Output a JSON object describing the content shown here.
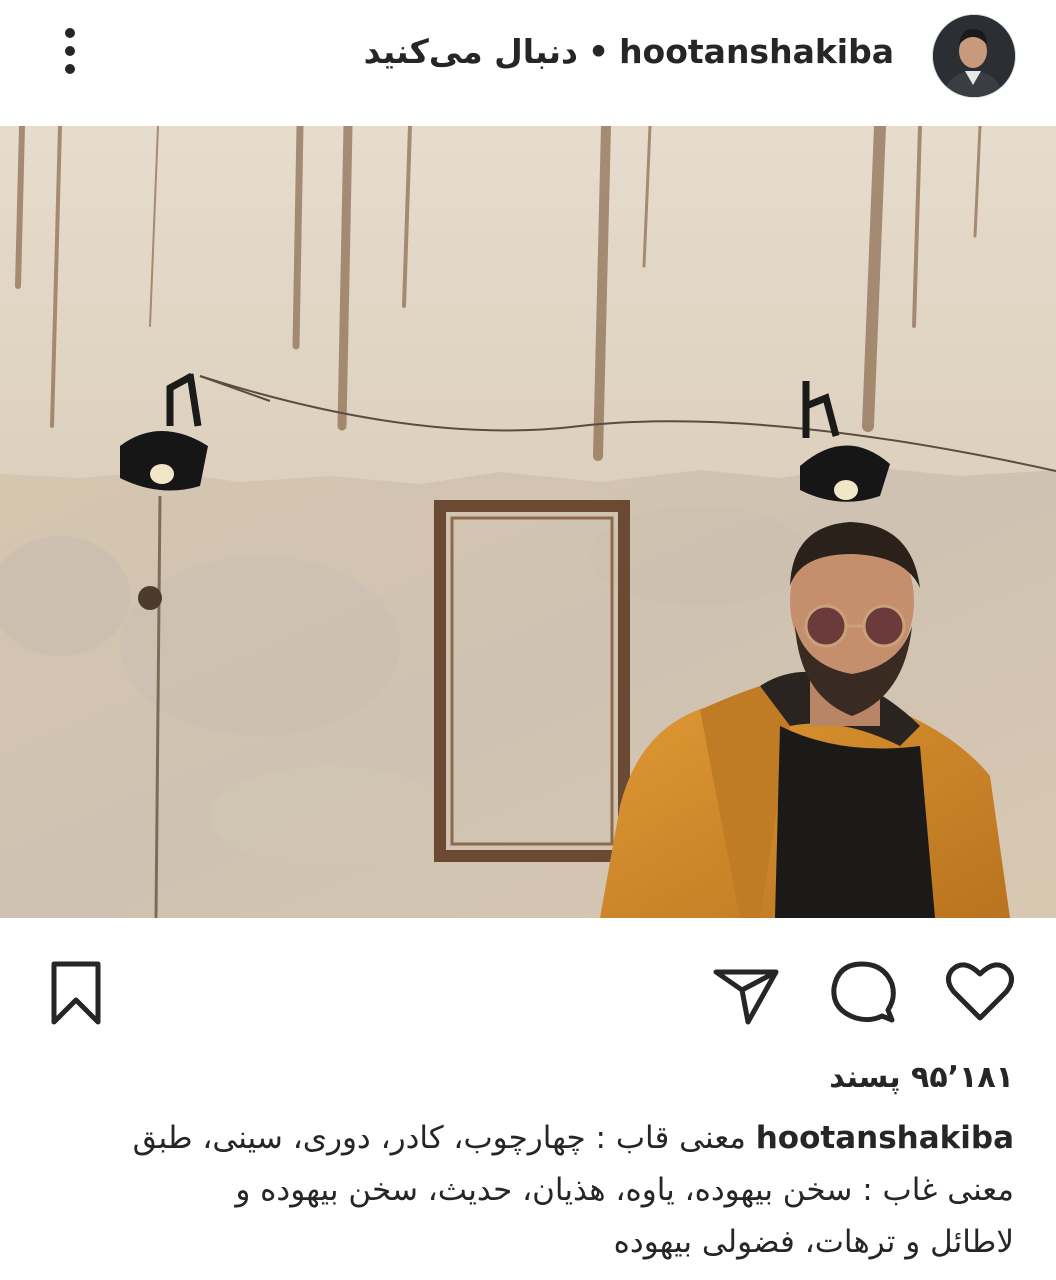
{
  "post": {
    "username": "hootanshakiba",
    "separator": "•",
    "follow_status": "دنبال می‌کنید",
    "likes": "۹۵٬۱۸۱ پسند",
    "caption": {
      "line1": "معنی قاب : چهارچوب، کادر، دوری، سینی، طبق",
      "line2": "معنی غاب : سخن بیهوده، یاوه، هذیان، حدیث، سخن بیهوده و",
      "line3": "لاطائل و ترهات، فضولی بیهوده"
    }
  },
  "icons": {
    "more": "more-vertical-icon",
    "like": "heart-icon",
    "comment": "comment-bubble-icon",
    "share": "paper-plane-icon",
    "save": "bookmark-icon"
  },
  "colors": {
    "text": "#262626",
    "background": "#ffffff",
    "jacket": "#d38a2a",
    "wall": "#e2d6c6"
  }
}
